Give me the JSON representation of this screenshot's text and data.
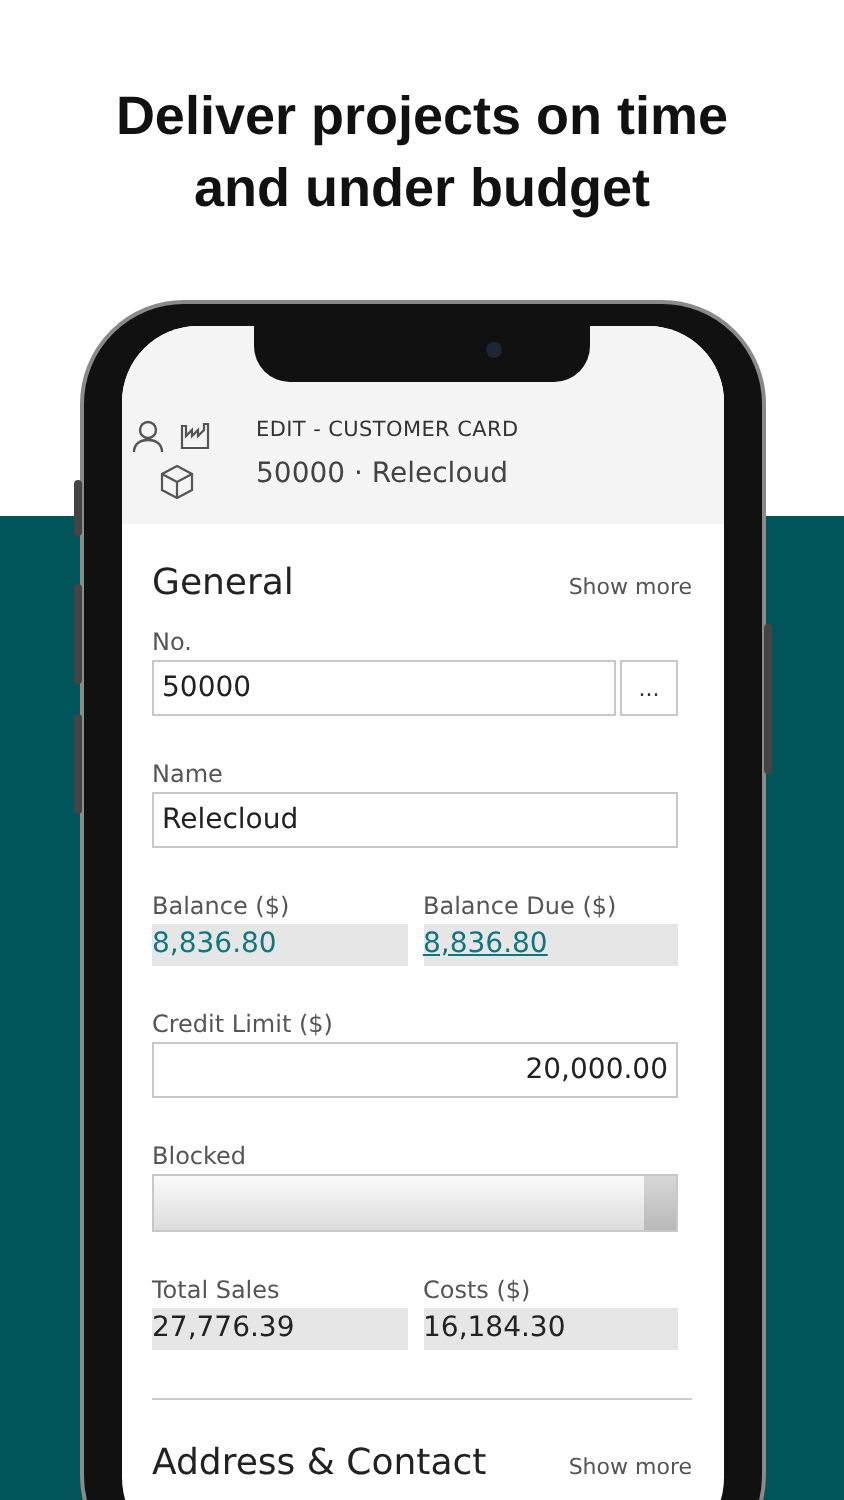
{
  "headline": "Deliver projects on time and under budget",
  "header": {
    "title": "EDIT - CUSTOMER CARD",
    "subtitle": "50000 · Relecloud"
  },
  "sections": [
    {
      "title": "General",
      "action": "Show more",
      "rows": [
        [
          {
            "kind": "lookup",
            "label": "No.",
            "value": "50000",
            "button": "..."
          }
        ],
        [
          {
            "kind": "input",
            "label": "Name",
            "value": "Relecloud"
          }
        ],
        [
          {
            "kind": "readonly",
            "label": "Balance ($)",
            "value": "8,836.80",
            "drilldown": true,
            "underlined": false
          },
          {
            "kind": "readonly",
            "label": "Balance Due ($)",
            "value": "8,836.80",
            "drilldown": true,
            "underlined": true
          }
        ],
        [
          {
            "kind": "amount",
            "label": "Credit Limit ($)",
            "value": "20,000.00"
          }
        ],
        [
          {
            "kind": "dropdown",
            "label": "Blocked"
          }
        ],
        [
          {
            "kind": "readonly",
            "label": "Total Sales",
            "value": "27,776.39",
            "drilldown": false,
            "underlined": false
          },
          {
            "kind": "readonly",
            "label": "Costs ($)",
            "value": "16,184.30",
            "drilldown": false,
            "underlined": false
          }
        ]
      ]
    },
    {
      "title": "Address & Contact",
      "action": "Show more"
    }
  ]
}
